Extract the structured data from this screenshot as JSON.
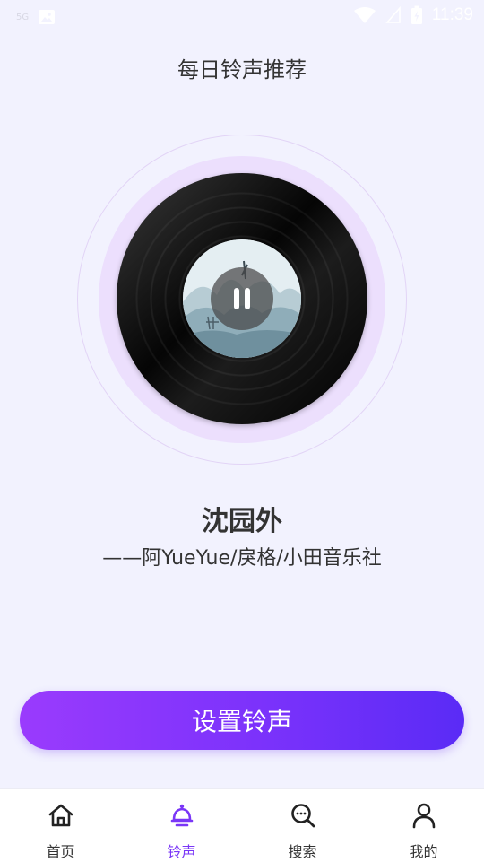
{
  "status_bar": {
    "signal_text": "5G",
    "time": "11:39"
  },
  "page_title": "每日铃声推荐",
  "song": {
    "title": "沈园外",
    "artist": "——阿YueYue/戾格/小田音乐社"
  },
  "actions": {
    "set_ringtone_label": "设置铃声"
  },
  "nav": {
    "items": [
      {
        "label": "首页",
        "icon": "home-icon",
        "active": false
      },
      {
        "label": "铃声",
        "icon": "bell-icon",
        "active": true
      },
      {
        "label": "搜索",
        "icon": "search-icon",
        "active": false
      },
      {
        "label": "我的",
        "icon": "profile-icon",
        "active": false
      }
    ]
  },
  "colors": {
    "accent": "#7a36f7",
    "button_gradient_start": "#9a3bfd",
    "button_gradient_end": "#5a2bf6",
    "background": "#f2f2fe"
  }
}
